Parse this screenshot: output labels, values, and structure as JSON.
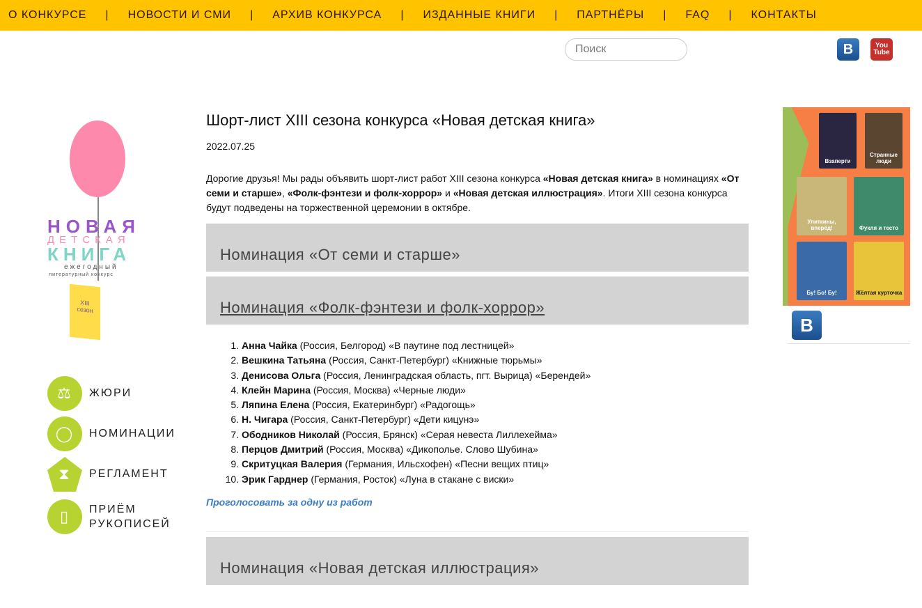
{
  "nav": [
    "О КОНКУРСЕ",
    "НОВОСТИ И СМИ",
    "АРХИВ КОНКУРСА",
    "ИЗДАННЫЕ КНИГИ",
    "ПАРТНЁРЫ",
    "FAQ",
    "КОНТАКТЫ"
  ],
  "search": {
    "placeholder": "Поиск"
  },
  "social": {
    "vk": "B",
    "yt_top": "You",
    "yt_bottom": "Tube"
  },
  "logo": {
    "line1": "НОВАЯ",
    "line2": "ДЕТСКАЯ",
    "line3": "КНИГА",
    "sub1": "ежегодный",
    "sub2": "литературный конкурс",
    "season": "XIII сезон"
  },
  "side_menu": [
    "ЖЮРИ",
    "НОМИНАЦИИ",
    "РЕГЛАМЕНТ",
    "ПРИЁМ РУКОПИСЕЙ"
  ],
  "article": {
    "title": "Шорт-лист XIII сезона конкурса «Новая детская книга»",
    "date": "2022.07.25",
    "intro": [
      "Дорогие друзья! Мы рады объявить шорт-лист работ XIII сезона конкурса ",
      "«Новая детская книга»",
      " в номинациях ",
      "«От семи и старше»",
      ", ",
      "«Фолк-фэнтези и фолк-хоррор»",
      " и ",
      "«Новая детская иллюстрация»",
      ". Итоги XIII сезона конкурса будут подведены на торжественной церемонии в октябре."
    ],
    "nominations": [
      "Номинация «От семи и старше»",
      "Номинация «Фолк-фэнтези и фолк-хоррор»",
      "Номинация «Новая детская иллюстрация»"
    ],
    "list": [
      {
        "name": "Анна Чайка",
        "rest": " (Россия, Белгород) «В паутине под лестницей»"
      },
      {
        "name": "Вешкина Татьяна",
        "rest": " (Россия, Санкт-Петербург) «Книжные тюрьмы»"
      },
      {
        "name": "Денисова Ольга",
        "rest": " (Россия, Ленинградская область, пгт. Вырица) «Берендей»"
      },
      {
        "name": "Клейн Марина",
        "rest": " (Россия, Москва) «Черные люди»"
      },
      {
        "name": "Ляпина Елена",
        "rest": " (Россия, Екатеринбург) «Радогощь»"
      },
      {
        "name": "Н. Чигара",
        "rest": " (Россия, Санкт-Петербург) «Дети кицунэ»"
      },
      {
        "name": "Ободников Николай",
        "rest": " (Россия, Брянск) «Серая невеста Лиллехейма»"
      },
      {
        "name": "Перцов Дмитрий",
        "rest": " (Россия, Москва) «Дикополье. Слово Шубина»"
      },
      {
        "name": "Скритуцкая Валерия",
        "rest": " (Германия, Ильсхофен) «Песни вещих птиц»"
      },
      {
        "name": "Эрик Гарднер",
        "rest": " (Германия, Росток) «Луна в стакане с виски»"
      }
    ],
    "vote": "Проголосовать за одну из работ"
  },
  "books": [
    "Взаперти",
    "Странные люди",
    "Улиткины, вперёд!",
    "Фукля и тесто",
    "Бу! Бо! Бу!",
    "Жёлтая курточка"
  ]
}
